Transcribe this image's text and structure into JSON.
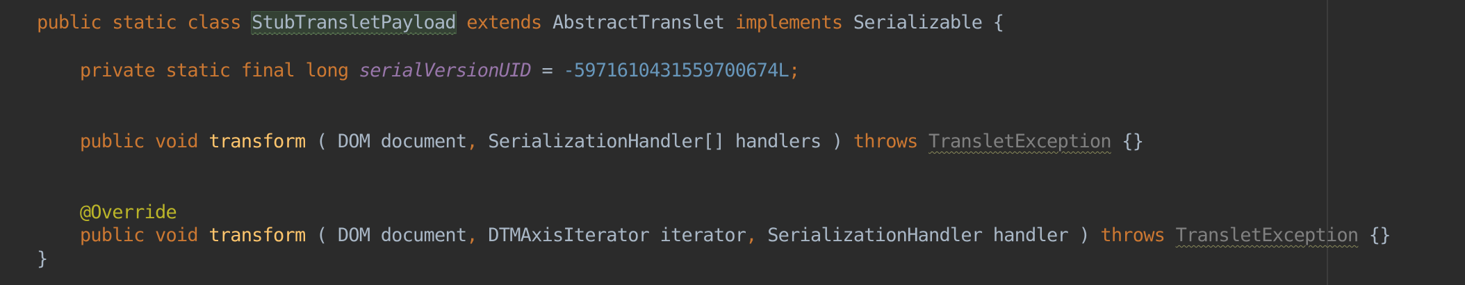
{
  "code": {
    "line1": {
      "public": "public",
      "static": "static",
      "class": "class",
      "class_name": "StubTransletPayload",
      "extends": "extends",
      "parent_class": "AbstractTranslet",
      "implements": "implements",
      "interface_name": "Serializable",
      "brace": "{"
    },
    "line2": {
      "private": "private",
      "static": "static",
      "final": "final",
      "long": "long",
      "field_name": "serialVersionUID",
      "assign": "=",
      "value": "-5971610431559700674L",
      "semicolon": ";"
    },
    "line3": {
      "public": "public",
      "void": "void",
      "method": "transform",
      "open_paren": "(",
      "type1": "DOM",
      "param1": "document",
      "comma": ",",
      "type2": "SerializationHandler[]",
      "param2": "handlers",
      "close_paren": ")",
      "throws": "throws",
      "exception": "TransletException",
      "body": "{}"
    },
    "line4": {
      "annotation": "@Override"
    },
    "line5": {
      "public": "public",
      "void": "void",
      "method": "transform",
      "open_paren": "(",
      "type1": "DOM",
      "param1": "document",
      "comma1": ",",
      "type2": "DTMAxisIterator",
      "param2": "iterator",
      "comma2": ",",
      "type3": "SerializationHandler",
      "param3": "handler",
      "close_paren": ")",
      "throws": "throws",
      "exception": "TransletException",
      "body": "{}"
    },
    "line6": {
      "brace": "}"
    }
  },
  "colors": {
    "background": "#2b2b2b",
    "keyword": "#cc7832",
    "identifier": "#a9b7c6",
    "method": "#ffc66d",
    "number": "#6897bb",
    "annotation": "#bbb529",
    "static_field": "#9876aa",
    "unresolved": "#808080"
  }
}
